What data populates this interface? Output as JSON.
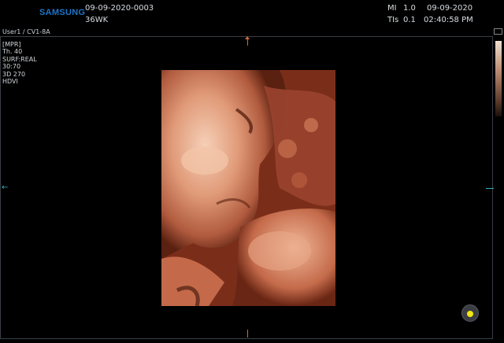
{
  "header": {
    "brand": "SAMSUNG",
    "patient_id": "09-09-2020-0003",
    "gestational_age": "36WK",
    "mi_label": "MI",
    "mi_value": "1.0",
    "tis_label": "TIs",
    "tis_value": "0.1",
    "date": "09-09-2020",
    "time": "02:40:58 PM"
  },
  "probe_info": "User1 / CV1-8A",
  "parameters": [
    "[MPR]",
    "Th. 40",
    "SURF:REAL",
    "30:70",
    "3D 270",
    "HDVI"
  ],
  "markers": {
    "left_arrow": "←",
    "right_marker": "•"
  },
  "colors": {
    "brand": "#1d75c8",
    "marker": "#2ab3c0",
    "tick": "#cf6a3a",
    "trackball_indicator": "#f5e80e"
  }
}
